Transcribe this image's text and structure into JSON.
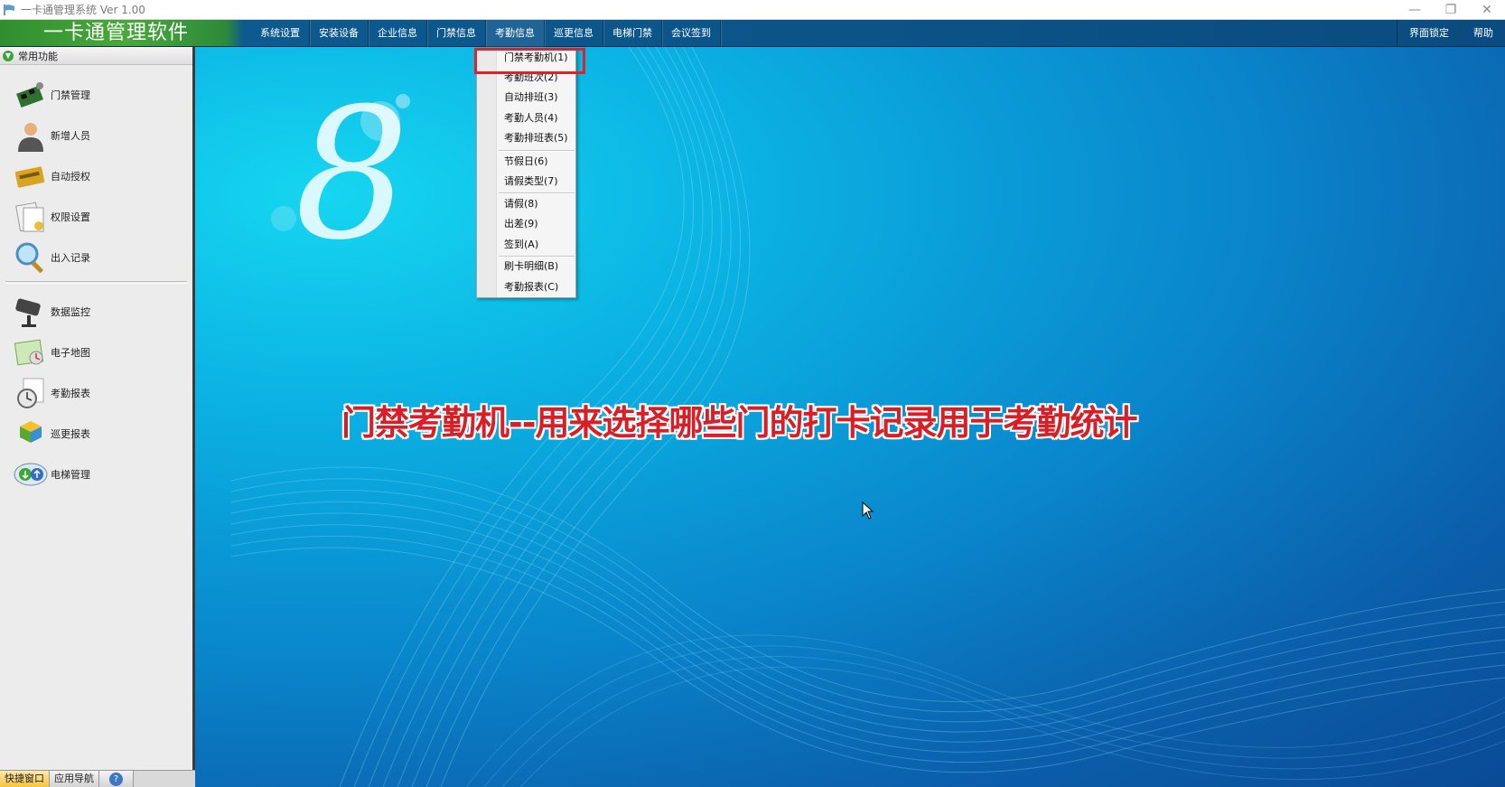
{
  "window": {
    "title": "一卡通管理系统  Ver 1.00",
    "controls": [
      "—",
      "❐",
      "✕"
    ]
  },
  "menubar": {
    "app_name": "一卡通管理软件",
    "items": [
      "系统设置",
      "安装设备",
      "企业信息",
      "门禁信息",
      "考勤信息",
      "巡更信息",
      "电梯门禁",
      "会议签到"
    ],
    "right_items": [
      "界面锁定",
      "帮助"
    ]
  },
  "sidebar": {
    "header": "常用功能",
    "group1": [
      "门禁管理",
      "新增人员",
      "自动授权",
      "权限设置",
      "出入记录"
    ],
    "group2": [
      "数据监控",
      "电子地图",
      "考勤报表",
      "巡更报表",
      "电梯管理"
    ]
  },
  "bottom_tabs": {
    "quick": "快捷窗口",
    "nav": "应用导航",
    "help": "?"
  },
  "dropdown": {
    "items": [
      "门禁考勤机(1)",
      "考勤班次(2)",
      "自动排班(3)",
      "考勤人员(4)",
      "考勤排班表(5)",
      "节假日(6)",
      "请假类型(7)",
      "请假(8)",
      "出差(9)",
      "签到(A)",
      "刷卡明细(B)",
      "考勤报表(C)"
    ]
  },
  "caption": "门禁考勤机--用来选择哪些门的打卡记录用于考勤统计",
  "colors": {
    "highlight": "#e0202a",
    "caption": "#d81e26"
  }
}
